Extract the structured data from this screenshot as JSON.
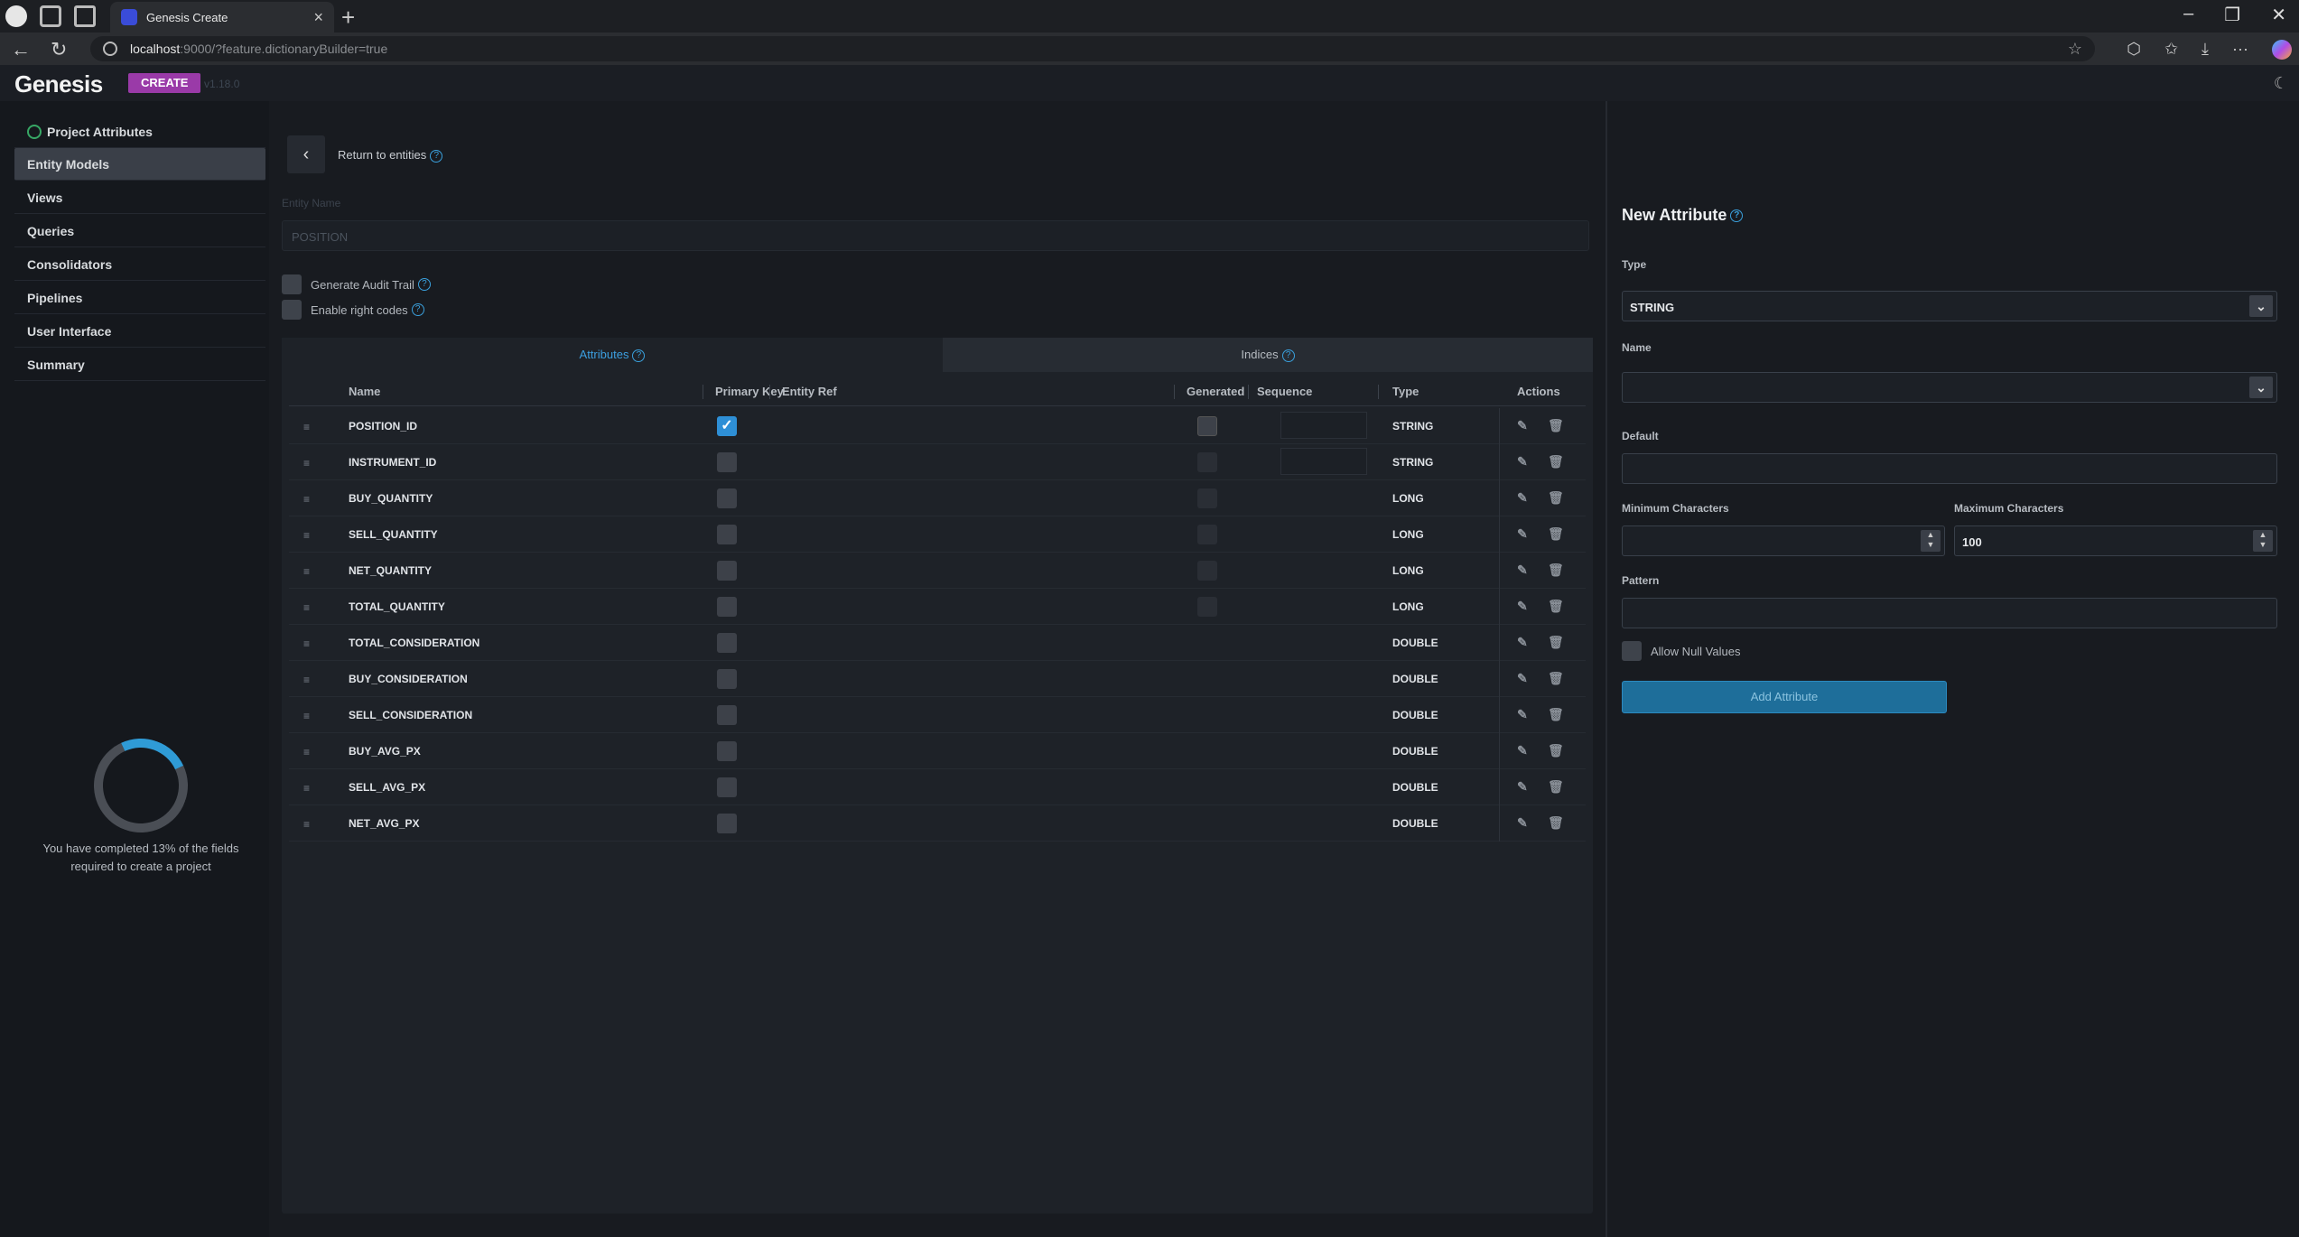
{
  "browser": {
    "tab_title": "Genesis Create",
    "url_host": "localhost",
    "url_rest": ":9000/?feature.dictionaryBuilder=true"
  },
  "app": {
    "logo": "Genesis",
    "badge": "CREATE",
    "version": "v1.18.0"
  },
  "sidebar": {
    "items": [
      {
        "label": "Project Attributes"
      },
      {
        "label": "Entity Models"
      },
      {
        "label": "Views"
      },
      {
        "label": "Queries"
      },
      {
        "label": "Consolidators"
      },
      {
        "label": "Pipelines"
      },
      {
        "label": "User Interface"
      },
      {
        "label": "Summary"
      }
    ],
    "progress_percent": 13,
    "progress_text": "You have completed 13% of the fields required to create a project"
  },
  "main": {
    "return_label": "Return to entities",
    "entity_name_label": "Entity Name",
    "entity_name_value": "POSITION",
    "audit_trail_label": "Generate Audit Trail",
    "right_codes_label": "Enable right codes",
    "tab_attributes": "Attributes",
    "tab_indices": "Indices",
    "columns": {
      "name": "Name",
      "primary_key": "Primary Key",
      "entity_ref": "Entity Ref",
      "generated": "Generated",
      "sequence": "Sequence",
      "type": "Type",
      "actions": "Actions"
    },
    "rows": [
      {
        "name": "POSITION_ID",
        "type": "STRING"
      },
      {
        "name": "INSTRUMENT_ID",
        "type": "STRING"
      },
      {
        "name": "BUY_QUANTITY",
        "type": "LONG"
      },
      {
        "name": "SELL_QUANTITY",
        "type": "LONG"
      },
      {
        "name": "NET_QUANTITY",
        "type": "LONG"
      },
      {
        "name": "TOTAL_QUANTITY",
        "type": "LONG"
      },
      {
        "name": "TOTAL_CONSIDERATION",
        "type": "DOUBLE"
      },
      {
        "name": "BUY_CONSIDERATION",
        "type": "DOUBLE"
      },
      {
        "name": "SELL_CONSIDERATION",
        "type": "DOUBLE"
      },
      {
        "name": "BUY_AVG_PX",
        "type": "DOUBLE"
      },
      {
        "name": "SELL_AVG_PX",
        "type": "DOUBLE"
      },
      {
        "name": "NET_AVG_PX",
        "type": "DOUBLE"
      }
    ]
  },
  "new_attribute": {
    "title": "New Attribute",
    "type_label": "Type",
    "type_value": "STRING",
    "name_label": "Name",
    "name_value": "",
    "default_label": "Default",
    "min_label": "Minimum Characters",
    "min_value": "",
    "max_label": "Maximum Characters",
    "max_value": "100",
    "pattern_label": "Pattern",
    "allow_null_label": "Allow Null Values",
    "add_button": "Add Attribute"
  }
}
